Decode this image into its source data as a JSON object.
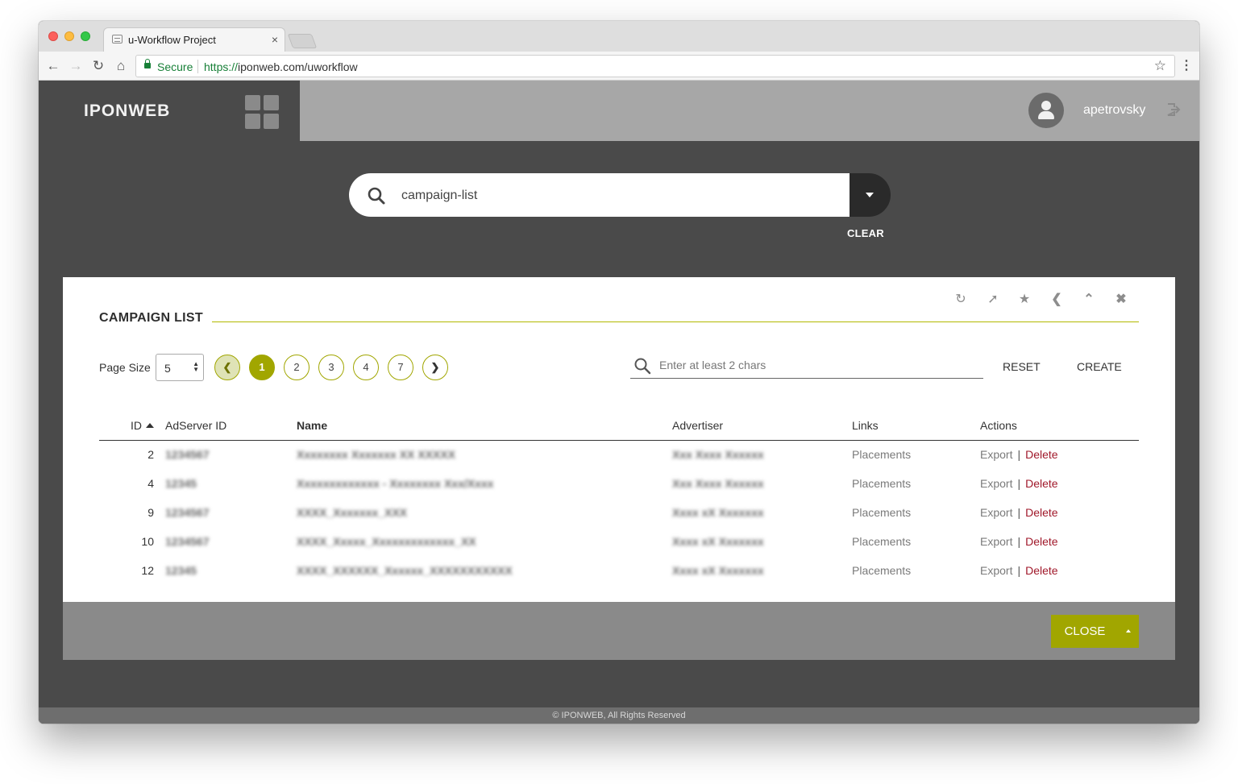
{
  "browser": {
    "tab_title": "u-Workflow Project",
    "tab_close": "×",
    "secure_label": "Secure",
    "url_scheme": "https://",
    "url_rest": "iponweb.com/uworkflow"
  },
  "header": {
    "logo": "IPONWEB",
    "username": "apetrovsky"
  },
  "search": {
    "value": "campaign-list",
    "clear_label": "CLEAR"
  },
  "panel": {
    "title": "CAMPAIGN LIST",
    "page_size_label": "Page Size",
    "page_size_value": "5",
    "pages": [
      "1",
      "2",
      "3",
      "4",
      "7"
    ],
    "active_page": "1",
    "filter_placeholder": "Enter at least 2 chars",
    "reset_label": "RESET",
    "create_label": "CREATE",
    "columns": {
      "id": "ID",
      "adserver_id": "AdServer ID",
      "name": "Name",
      "advertiser": "Advertiser",
      "links": "Links",
      "actions": "Actions"
    },
    "rows": [
      {
        "id": "2",
        "adserver_id": "1234567",
        "name": "Xxxxxxxx Xxxxxxx XX XXXXX",
        "advertiser": "Xxx Xxxx Xxxxxx",
        "link": "Placements",
        "export": "Export",
        "delete": "Delete"
      },
      {
        "id": "4",
        "adserver_id": "12345",
        "name": "Xxxxxxxxxxxxx - Xxxxxxxx Xxx/Xxxx",
        "advertiser": "Xxx Xxxx Xxxxxx",
        "link": "Placements",
        "export": "Export",
        "delete": "Delete"
      },
      {
        "id": "9",
        "adserver_id": "1234567",
        "name": "XXXX_Xxxxxxx_XXX",
        "advertiser": "Xxxx xX Xxxxxxx",
        "link": "Placements",
        "export": "Export",
        "delete": "Delete"
      },
      {
        "id": "10",
        "adserver_id": "1234567",
        "name": "XXXX_Xxxxx_Xxxxxxxxxxxxx_XX",
        "advertiser": "Xxxx xX Xxxxxxx",
        "link": "Placements",
        "export": "Export",
        "delete": "Delete"
      },
      {
        "id": "12",
        "adserver_id": "12345",
        "name": "XXXX_XXXXXX_Xxxxxx_XXXXXXXXXXX",
        "advertiser": "Xxxx xX Xxxxxxx",
        "link": "Placements",
        "export": "Export",
        "delete": "Delete"
      }
    ],
    "close_label": "CLOSE"
  },
  "footer": {
    "copyright": "© IPONWEB, All Rights Reserved"
  },
  "icons": {
    "refresh": "refresh-icon",
    "pin": "pin-icon",
    "favorite": "star-icon",
    "back": "chevron-left-icon",
    "collapse": "chevron-up-icon",
    "close": "close-icon"
  },
  "colors": {
    "accent": "#a1a600",
    "delete": "#a0182a",
    "app_bg": "#4a4a4a",
    "header_right": "#a7a7a7"
  }
}
